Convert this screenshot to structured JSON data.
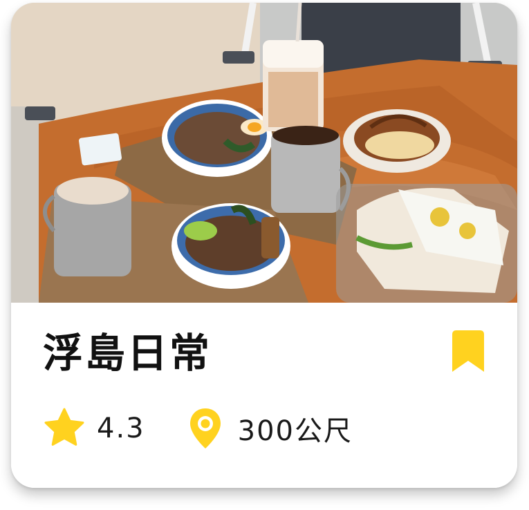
{
  "card": {
    "title": "浮島日常",
    "rating": "4.3",
    "distance": "300公尺",
    "accent_color": "#FFD21F",
    "icons": {
      "rating": "star-icon",
      "distance": "location-pin-icon",
      "save": "bookmark-icon"
    }
  }
}
